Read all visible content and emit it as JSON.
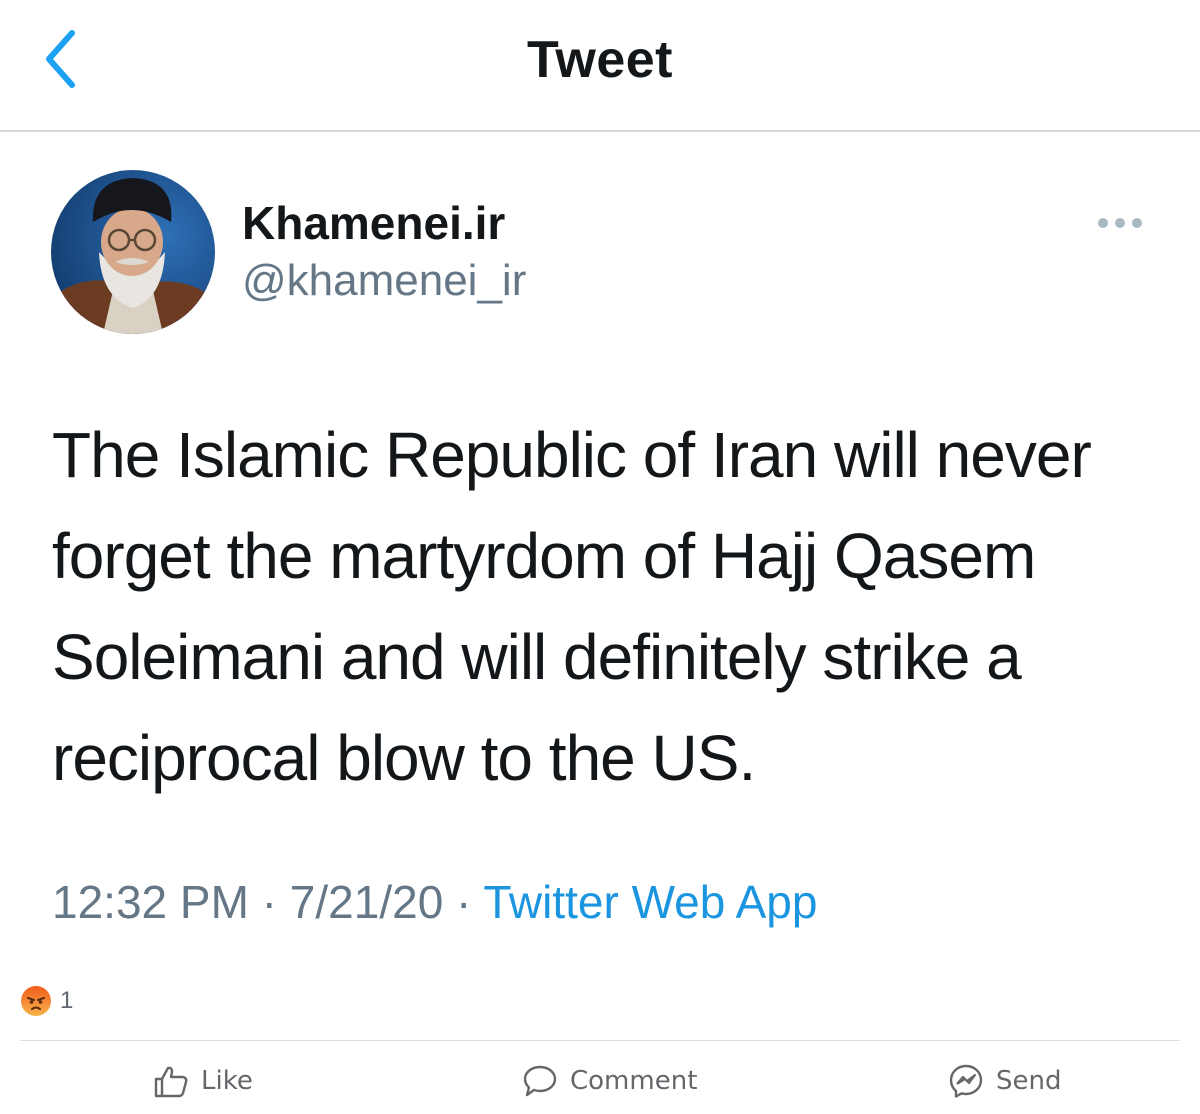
{
  "header": {
    "title": "Tweet",
    "back_icon": "chevron-left-icon",
    "accent_color": "#1da1f2"
  },
  "tweet": {
    "display_name": "Khamenei.ir",
    "handle": "@khamenei_ir",
    "text": "The Islamic Republic of Iran will never forget the martyrdom of Hajj Qasem Soleimani and will definitely strike a reciprocal blow to the US.",
    "time": "12:32 PM",
    "separator": " · ",
    "date": "7/21/20",
    "source": "Twitter Web App",
    "more_icon": "more-dots-icon"
  },
  "post_footer": {
    "reaction_icon": "angry-emoji-icon",
    "reaction_count": "1",
    "actions": {
      "like": "Like",
      "comment": "Comment",
      "send": "Send"
    }
  },
  "colors": {
    "link": "#1b95e0",
    "muted": "#657786",
    "text": "#14171a"
  }
}
